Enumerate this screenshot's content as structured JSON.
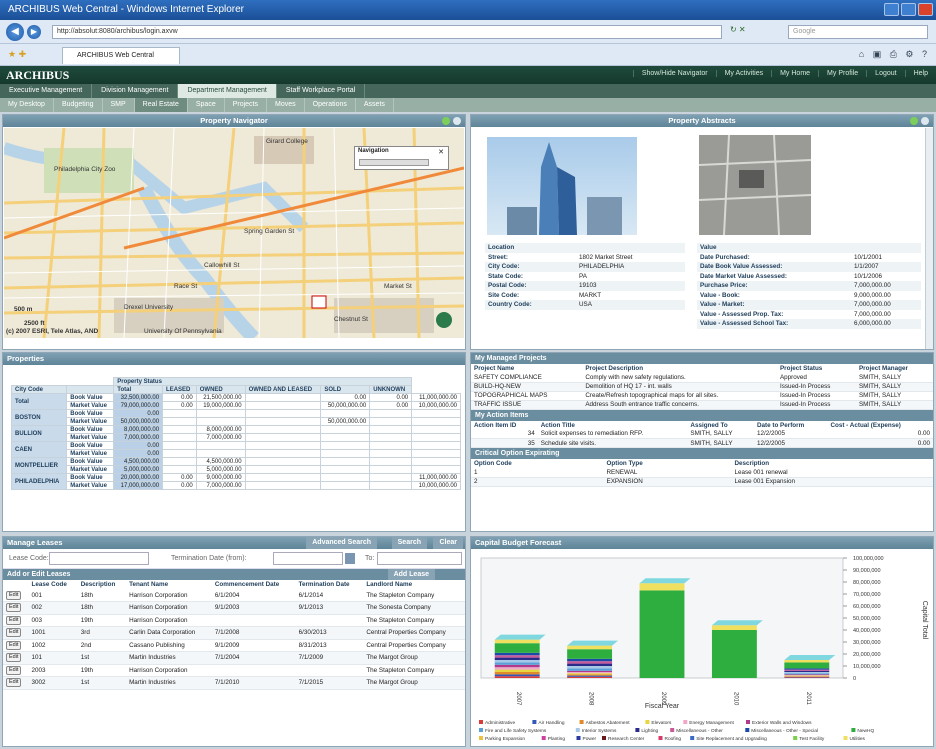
{
  "browser": {
    "title": "ARCHIBUS Web Central - Windows Internet Explorer",
    "url": "http://absolut:8080/archibus/login.axvw",
    "search_placeholder": "Google",
    "tab_label": "ARCHIBUS Web Central"
  },
  "app": {
    "logo": "ARCHIBUS",
    "top_links": [
      "Show/Hide Navigator",
      "My Activities",
      "My Home",
      "My Profile",
      "Logout",
      "Help"
    ],
    "primary_tabs": [
      "Executive Management",
      "Division Management",
      "Department Management",
      "Staff Workplace Portal"
    ],
    "primary_active": 2,
    "secondary_tabs": [
      "My Desktop",
      "Budgeting",
      "SMP",
      "Real Estate",
      "Space",
      "Projects",
      "Moves",
      "Operations",
      "Assets"
    ],
    "secondary_active": 3
  },
  "navigator": {
    "title": "Property Navigator",
    "nav_label": "Navigation",
    "scale_m": "500 m",
    "scale_ft": "2500 ft",
    "copyright": "(c) 2007 ESRI, Tele Atlas, AND",
    "labels": [
      "Girard College",
      "Philadelphia City Zoo",
      "Drexel University",
      "Chestnut St",
      "Spring Garden St",
      "Callowhill St",
      "Race St",
      "Market St",
      "University Of Pennsylvania"
    ]
  },
  "abstracts": {
    "title": "Property Abstracts",
    "location_head": "Location",
    "value_head": "Value",
    "location": [
      {
        "k": "Street:",
        "v": "1802 Market Street"
      },
      {
        "k": "City Code:",
        "v": "PHILADELPHIA"
      },
      {
        "k": "State Code:",
        "v": "PA"
      },
      {
        "k": "Postal Code:",
        "v": "19103"
      },
      {
        "k": "Site Code:",
        "v": "MARKT"
      },
      {
        "k": "Country Code:",
        "v": "USA"
      }
    ],
    "value": [
      {
        "k": "Date Purchased:",
        "v": "10/1/2001"
      },
      {
        "k": "Date Book Value Assessed:",
        "v": "1/1/2007"
      },
      {
        "k": "Date Market Value Assessed:",
        "v": "10/1/2006"
      },
      {
        "k": "Purchase Price:",
        "v": "7,000,000.00"
      },
      {
        "k": "Value - Book:",
        "v": "9,000,000.00"
      },
      {
        "k": "Value - Market:",
        "v": "7,000,000.00"
      },
      {
        "k": "Value - Assessed Prop. Tax:",
        "v": "7,000,000.00"
      },
      {
        "k": "Value - Assessed School Tax:",
        "v": "6,000,000.00"
      }
    ]
  },
  "properties": {
    "title": "Properties",
    "status_head": "Property Status",
    "headers": [
      "City Code",
      "",
      "Total",
      "LEASED",
      "OWNED",
      "OWNED AND LEASED",
      "SOLD",
      "UNKNOWN"
    ],
    "rows": [
      {
        "city": "Total",
        "lines": [
          [
            "Book Value",
            "32,500,000.00",
            "0.00",
            "21,500,000.00",
            "",
            "0.00",
            "0.00",
            "11,000,000.00"
          ],
          [
            "Market Value",
            "79,000,000.00",
            "0.00",
            "19,000,000.00",
            "",
            "50,000,000.00",
            "0.00",
            "10,000,000.00"
          ]
        ]
      },
      {
        "city": "BOSTON",
        "lines": [
          [
            "Book Value",
            "0.00",
            "",
            "",
            "",
            "",
            "",
            ""
          ],
          [
            "Market Value",
            "50,000,000.00",
            "",
            "",
            "",
            "50,000,000.00",
            "",
            ""
          ]
        ]
      },
      {
        "city": "BULLION",
        "lines": [
          [
            "Book Value",
            "8,000,000.00",
            "",
            "8,000,000.00",
            "",
            "",
            "",
            ""
          ],
          [
            "Market Value",
            "7,000,000.00",
            "",
            "7,000,000.00",
            "",
            "",
            "",
            ""
          ]
        ]
      },
      {
        "city": "CAEN",
        "lines": [
          [
            "Book Value",
            "0.00",
            "",
            "",
            "",
            "",
            "",
            ""
          ],
          [
            "Market Value",
            "0.00",
            "",
            "",
            "",
            "",
            "",
            ""
          ]
        ]
      },
      {
        "city": "MONTPELLIER",
        "lines": [
          [
            "Book Value",
            "4,500,000.00",
            "",
            "4,500,000.00",
            "",
            "",
            "",
            ""
          ],
          [
            "Market Value",
            "5,000,000.00",
            "",
            "5,000,000.00",
            "",
            "",
            "",
            ""
          ]
        ]
      },
      {
        "city": "PHILADELPHIA",
        "lines": [
          [
            "Book Value",
            "20,000,000.00",
            "0.00",
            "9,000,000.00",
            "",
            "",
            "",
            "11,000,000.00"
          ],
          [
            "Market Value",
            "17,000,000.00",
            "0.00",
            "7,000,000.00",
            "",
            "",
            "",
            "10,000,000.00"
          ]
        ]
      }
    ]
  },
  "projects": {
    "title": "My Managed Projects",
    "headers": [
      "Project Name",
      "Project Description",
      "Project Status",
      "Project Manager"
    ],
    "rows": [
      [
        "SAFETY COMPLIANCE",
        "Comply with new safety regulations.",
        "Approved",
        "SMITH, SALLY"
      ],
      [
        "BUILD-HQ-NEW",
        "Demolition of HQ 17 - int. walls",
        "Issued-In Process",
        "SMITH, SALLY"
      ],
      [
        "TOPOGRAPHICAL MAPS",
        "Create/Refresh topographical maps for all sites.",
        "Issued-In Process",
        "SMITH, SALLY"
      ],
      [
        "TRAFFIC ISSUE",
        "Address South entrance traffic concerns.",
        "Issued-In Process",
        "SMITH, SALLY"
      ]
    ]
  },
  "actions": {
    "title": "My Action Items",
    "headers": [
      "Action Item ID",
      "Action Title",
      "Assigned To",
      "Date to Perform",
      "Cost - Actual (Expense)"
    ],
    "rows": [
      [
        "34",
        "Solicit expenses to remediation RFP.",
        "SMITH, SALLY",
        "12/2/2005",
        "0.00"
      ],
      [
        "35",
        "Schedule site visits.",
        "SMITH, SALLY",
        "12/2/2005",
        "0.00"
      ]
    ]
  },
  "options": {
    "title": "Critical Option Expirating",
    "headers": [
      "Option Code",
      "Option Type",
      "Description"
    ],
    "rows": [
      [
        "1",
        "RENEWAL",
        "Lease 001 renewal"
      ],
      [
        "2",
        "EXPANSION",
        "Lease 001 Expansion"
      ]
    ]
  },
  "leases": {
    "title": "Manage Leases",
    "advanced": "Advanced Search",
    "search": "Search",
    "clear": "Clear",
    "code_label": "Lease Code:",
    "term_label": "Termination Date (from):",
    "to_label": "To:",
    "edit_title": "Add or Edit Leases",
    "add": "Add Lease",
    "edit": "Edit",
    "headers": [
      "Lease Code",
      "Description",
      "Tenant Name",
      "Commencement Date",
      "Termination Date",
      "Landlord Name"
    ],
    "rows": [
      [
        "001",
        "18th",
        "Harrison Corporation",
        "6/1/2004",
        "6/1/2014",
        "The Stapleton Company"
      ],
      [
        "002",
        "18th",
        "Harrison Corporation",
        "9/1/2003",
        "9/1/2013",
        "The Sonesta Company"
      ],
      [
        "003",
        "19th",
        "Harrison Corporation",
        "",
        "",
        "The Stapleton Company"
      ],
      [
        "1001",
        "3rd",
        "Carlin Data Corporation",
        "7/1/2008",
        "6/30/2013",
        "Central Properties Company"
      ],
      [
        "1002",
        "2nd",
        "Cassano Publishing",
        "9/1/2009",
        "8/31/2013",
        "Central Properties Company"
      ],
      [
        "101",
        "1st",
        "Martin Industries",
        "7/1/2004",
        "7/1/2009",
        "The Margot Group"
      ],
      [
        "2003",
        "19th",
        "Harrison Corporation",
        "",
        "",
        "The Stapleton Company"
      ],
      [
        "3002",
        "1st",
        "Martin Industries",
        "7/1/2010",
        "7/1/2015",
        "The Margot Group"
      ]
    ]
  },
  "chart_data": {
    "type": "bar",
    "title": "Capital Budget Forecast",
    "xlabel": "Fiscal Year",
    "ylabel": "Capital Total",
    "ylim": [
      0,
      100000000
    ],
    "yticks": [
      "100,000,000",
      "90,000,000",
      "80,000,000",
      "70,000,000",
      "60,000,000",
      "50,000,000",
      "40,000,000",
      "30,000,000",
      "20,000,000",
      "10,000,000",
      "0"
    ],
    "categories": [
      "2007",
      "2008",
      "2009",
      "2010",
      "2011"
    ],
    "stacked": true,
    "series": [
      {
        "name": "Administrative",
        "color": "#d93a3a",
        "values": [
          1500000,
          1000000,
          0,
          0,
          500000
        ]
      },
      {
        "name": "Air Handling",
        "color": "#3458b8",
        "values": [
          1500000,
          1000000,
          0,
          0,
          500000
        ]
      },
      {
        "name": "Asbestos Abatement",
        "color": "#e08a2a",
        "values": [
          2000000,
          1000000,
          0,
          0,
          500000
        ]
      },
      {
        "name": "Elevators",
        "color": "#e6d640",
        "values": [
          2000000,
          1000000,
          0,
          0,
          500000
        ]
      },
      {
        "name": "Energy Management",
        "color": "#f0a8c8",
        "values": [
          2000000,
          1000000,
          0,
          0,
          500000
        ]
      },
      {
        "name": "Exterior Walls and Windows",
        "color": "#b13a8a",
        "values": [
          2000000,
          1000000,
          0,
          0,
          500000
        ]
      },
      {
        "name": "Fire and Life Safety Systems",
        "color": "#5aa0d8",
        "values": [
          2000000,
          2000000,
          0,
          0,
          1000000
        ]
      },
      {
        "name": "Interior Systems",
        "color": "#a8c8e8",
        "values": [
          2000000,
          2000000,
          0,
          0,
          1000000
        ]
      },
      {
        "name": "Lighting",
        "color": "#2a2a8a",
        "values": [
          2000000,
          2000000,
          0,
          0,
          1000000
        ]
      },
      {
        "name": "Miscellaneous - Other",
        "color": "#c85a9a",
        "values": [
          2000000,
          2000000,
          0,
          0,
          1000000
        ]
      },
      {
        "name": "Miscellaneous - Other - Special",
        "color": "#1a4aa8",
        "values": [
          2000000,
          2000000,
          0,
          0,
          1000000
        ]
      },
      {
        "name": "NewHQ",
        "color": "#2eae3e",
        "values": [
          8000000,
          8000000,
          73000000,
          40000000,
          5000000
        ]
      },
      {
        "name": "Parking Expansion",
        "color": "#f0c040",
        "values": [
          0,
          0,
          0,
          0,
          0
        ]
      },
      {
        "name": "Planting",
        "color": "#d040a0",
        "values": [
          0,
          0,
          0,
          0,
          0
        ]
      },
      {
        "name": "Power",
        "color": "#2a3aa0",
        "values": [
          0,
          0,
          0,
          0,
          0
        ]
      },
      {
        "name": "Research Center",
        "color": "#6a1a1a",
        "values": [
          0,
          0,
          0,
          0,
          0
        ]
      },
      {
        "name": "Roofing",
        "color": "#d83a6a",
        "values": [
          0,
          0,
          0,
          0,
          0
        ]
      },
      {
        "name": "Site Replacement and Upgrading",
        "color": "#3a6ac8",
        "values": [
          0,
          0,
          0,
          0,
          0
        ]
      },
      {
        "name": "Test Facility",
        "color": "#7ad04a",
        "values": [
          0,
          0,
          0,
          0,
          0
        ]
      },
      {
        "name": "Utilities",
        "color": "#f0e060",
        "values": [
          3000000,
          3000000,
          6000000,
          4000000,
          2000000
        ]
      }
    ],
    "legend_position": "bottom",
    "grid": false
  }
}
